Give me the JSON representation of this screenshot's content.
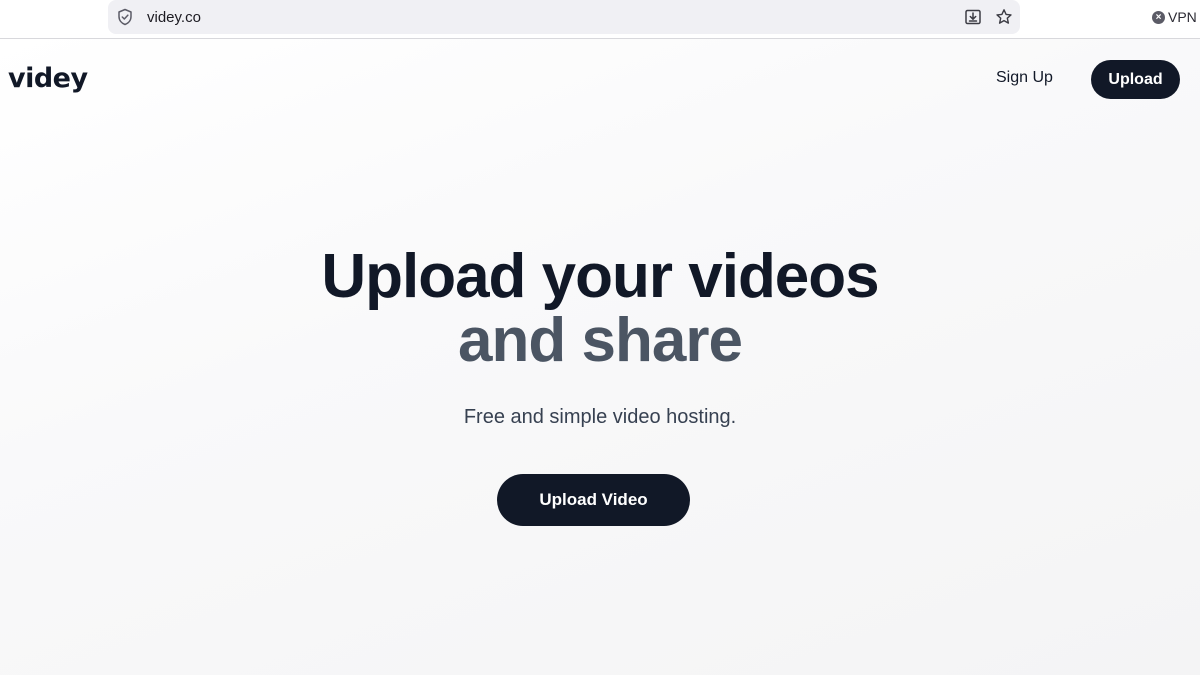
{
  "browser": {
    "url": "videy.co",
    "vpn_label": "VPN",
    "icons": {
      "site_info": "shield-icon",
      "download": "download-icon",
      "bookmark": "star-icon",
      "vpn_status": "close-circle-icon"
    }
  },
  "header": {
    "logo": "videy",
    "signup_label": "Sign Up",
    "upload_label": "Upload"
  },
  "hero": {
    "title_line1": "Upload your videos",
    "title_line2": "and share",
    "subtitle": "Free and simple video hosting.",
    "cta_label": "Upload Video"
  },
  "colors": {
    "primary": "#111827",
    "secondary_text": "#4b5563",
    "button_text": "#ffffff"
  }
}
